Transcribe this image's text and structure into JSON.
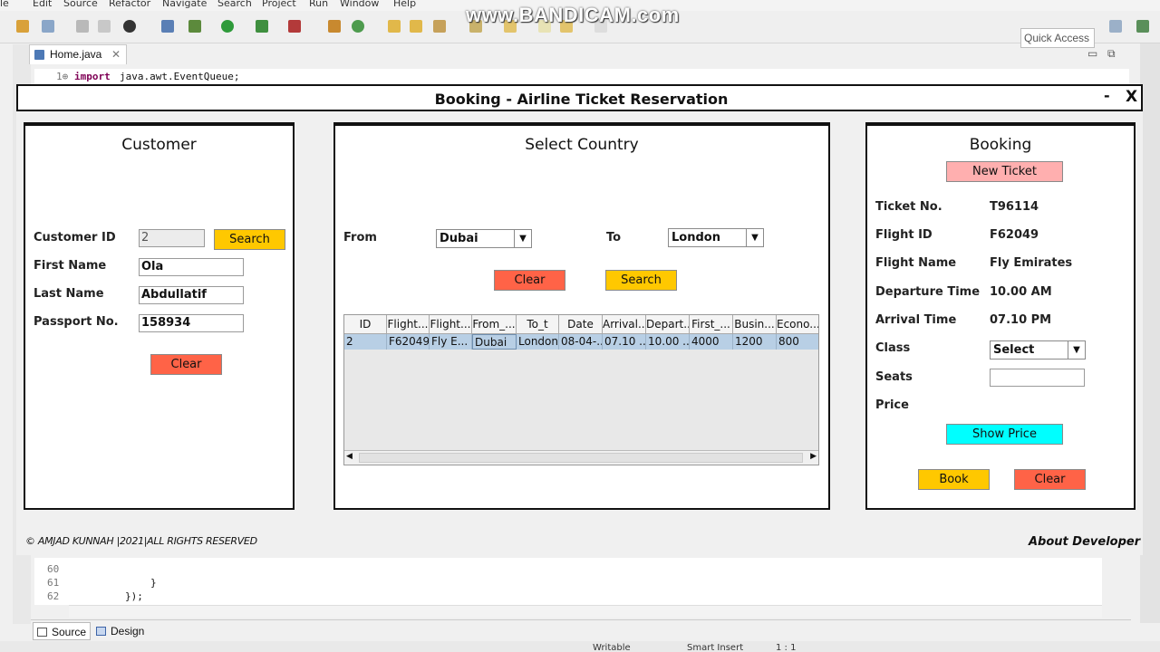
{
  "eclipse": {
    "menu": [
      "le",
      "Edit",
      "Source",
      "Refactor",
      "Navigate",
      "Search",
      "Project",
      "Run",
      "Window",
      "Help"
    ],
    "quick_access": "Quick Access",
    "watermark": "www.BANDICAM.com",
    "editor_tab": "Home.java",
    "code_top": {
      "line": "1⊕",
      "kw": "import",
      "text": "java.awt.EventQueue;"
    },
    "code_bottom": [
      {
        "ln": "60",
        "code": ""
      },
      {
        "ln": "61",
        "code": "}"
      },
      {
        "ln": "62",
        "code": "});"
      }
    ],
    "bottom_tabs": {
      "source": "Source",
      "design": "Design"
    },
    "status": {
      "writable": "Writable",
      "insert": "Smart Insert",
      "pos": "1 : 1"
    }
  },
  "window": {
    "title": "Booking - Airline Ticket Reservation",
    "minimize": "-",
    "close": "X"
  },
  "customer": {
    "title": "Customer",
    "id_label": "Customer ID",
    "id_value": "2",
    "search": "Search",
    "first_label": "First Name",
    "first_value": "Ola",
    "last_label": "Last Name",
    "last_value": "Abdullatif",
    "passport_label": "Passport No.",
    "passport_value": "158934",
    "clear": "Clear"
  },
  "country": {
    "title": "Select Country",
    "from_label": "From",
    "from_value": "Dubai",
    "to_label": "To",
    "to_value": "London",
    "clear": "Clear",
    "search": "Search",
    "columns": [
      "ID",
      "Flight...",
      "Flight...",
      "From_...",
      "To_t",
      "Date",
      "Arrival...",
      "Depart...",
      "First_...",
      "Busin...",
      "Econo..."
    ],
    "rows": [
      [
        "2",
        "F62049",
        "Fly E...",
        "Dubai",
        "London",
        "08-04-...",
        "07.10 ...",
        "10.00 ...",
        "4000",
        "1200",
        "800"
      ]
    ]
  },
  "booking": {
    "title": "Booking",
    "new_ticket": "New Ticket",
    "ticket_label": "Ticket No.",
    "ticket_value": "T96114",
    "flight_id_label": "Flight ID",
    "flight_id_value": "F62049",
    "flight_name_label": "Flight Name",
    "flight_name_value": "Fly Emirates",
    "departure_label": "Departure Time",
    "departure_value": "10.00 AM",
    "arrival_label": "Arrival Time",
    "arrival_value": "07.10 PM",
    "class_label": "Class",
    "class_value": "Select",
    "seats_label": "Seats",
    "seats_value": "",
    "price_label": "Price",
    "show_price": "Show Price",
    "book": "Book",
    "clear": "Clear"
  },
  "footer": {
    "copyright": "© AMJAD KUNNAH |2021|ALL RIGHTS RESERVED",
    "about": "About Developer"
  }
}
